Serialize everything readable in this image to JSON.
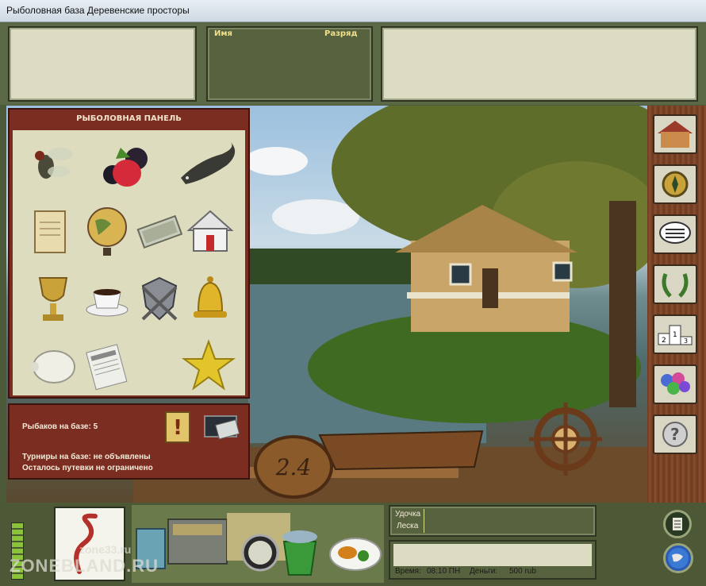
{
  "window": {
    "title": "Рыболовная база Деревенские просторы"
  },
  "top": {
    "name_label": "Имя",
    "rank_label": "Разряд"
  },
  "fishing_panel": {
    "title": "РЫБОЛОВНАЯ ПАНЕЛЬ",
    "items": [
      "fly-icon",
      "berries-icon",
      "catfish-icon",
      "certificate-icon",
      "globe-icon",
      "money-icon",
      "house-icon",
      "trophy-cup-icon",
      "coffee-cup-icon",
      "emblem-icon",
      "bell-icon",
      "piggy-bank-icon",
      "newspaper-icon",
      "star-icon"
    ]
  },
  "info": {
    "fishers": "Рыбаков на базе: 5",
    "tournaments": "Турниры на базе: не объявлены",
    "vouchers": "Осталось путевки не ограничено"
  },
  "sign": {
    "text": "2.4"
  },
  "sidebar": {
    "buttons": [
      "house-icon",
      "compass-icon",
      "chat-icon",
      "laurel-icon",
      "podium-icon",
      "people-icon",
      "help-icon"
    ]
  },
  "bottom": {
    "rod_label": "Удочка",
    "line_label": "Леска",
    "time_label": "Время:",
    "time_value": "08:10 ПН",
    "money_label": "Деньги:",
    "money_value": "500 rub",
    "watermark1": "zone33.ru",
    "watermark2": "ZONEBLAND.RU"
  },
  "colors": {
    "panel_red": "#7c2d22",
    "panel_beige": "#dedcbf",
    "olive": "#57633f",
    "label_yellow": "#f0e08a"
  }
}
